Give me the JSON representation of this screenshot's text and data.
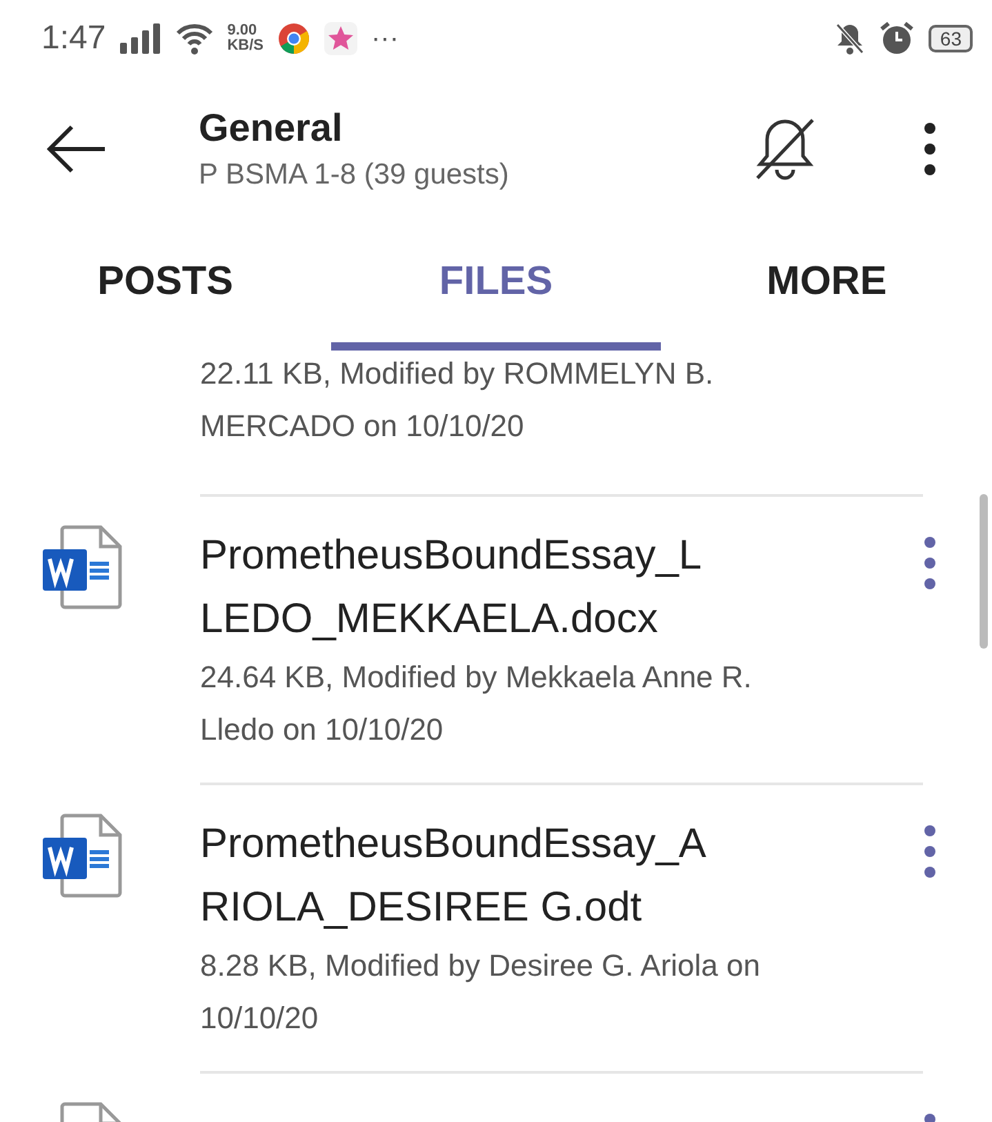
{
  "status_bar": {
    "time": "1:47",
    "speed_value": "9.00",
    "speed_unit": "KB/S",
    "more": "···",
    "battery": "63"
  },
  "header": {
    "title": "General",
    "subtitle": "P BSMA 1-8 (39 guests)"
  },
  "tabs": [
    {
      "label": "POSTS",
      "selected": false
    },
    {
      "label": "FILES",
      "selected": true
    },
    {
      "label": "MORE",
      "selected": false
    }
  ],
  "files": [
    {
      "meta": "22.11 KB, Modified by ROMMELYN B. MERCADO on 10/10/20"
    },
    {
      "kind": "word",
      "title": "PrometheusBoundEssay_LLEDO_MEKKAELA.docx",
      "meta": "24.64 KB, Modified by Mekkaela Anne R. Lledo on 10/10/20"
    },
    {
      "kind": "word",
      "title": "PrometheusBoundEssay_ARIOLA_DESIREE G.odt",
      "meta": "8.28 KB, Modified by Desiree G. Ariola on 10/10/20"
    },
    {
      "kind": "word"
    }
  ]
}
